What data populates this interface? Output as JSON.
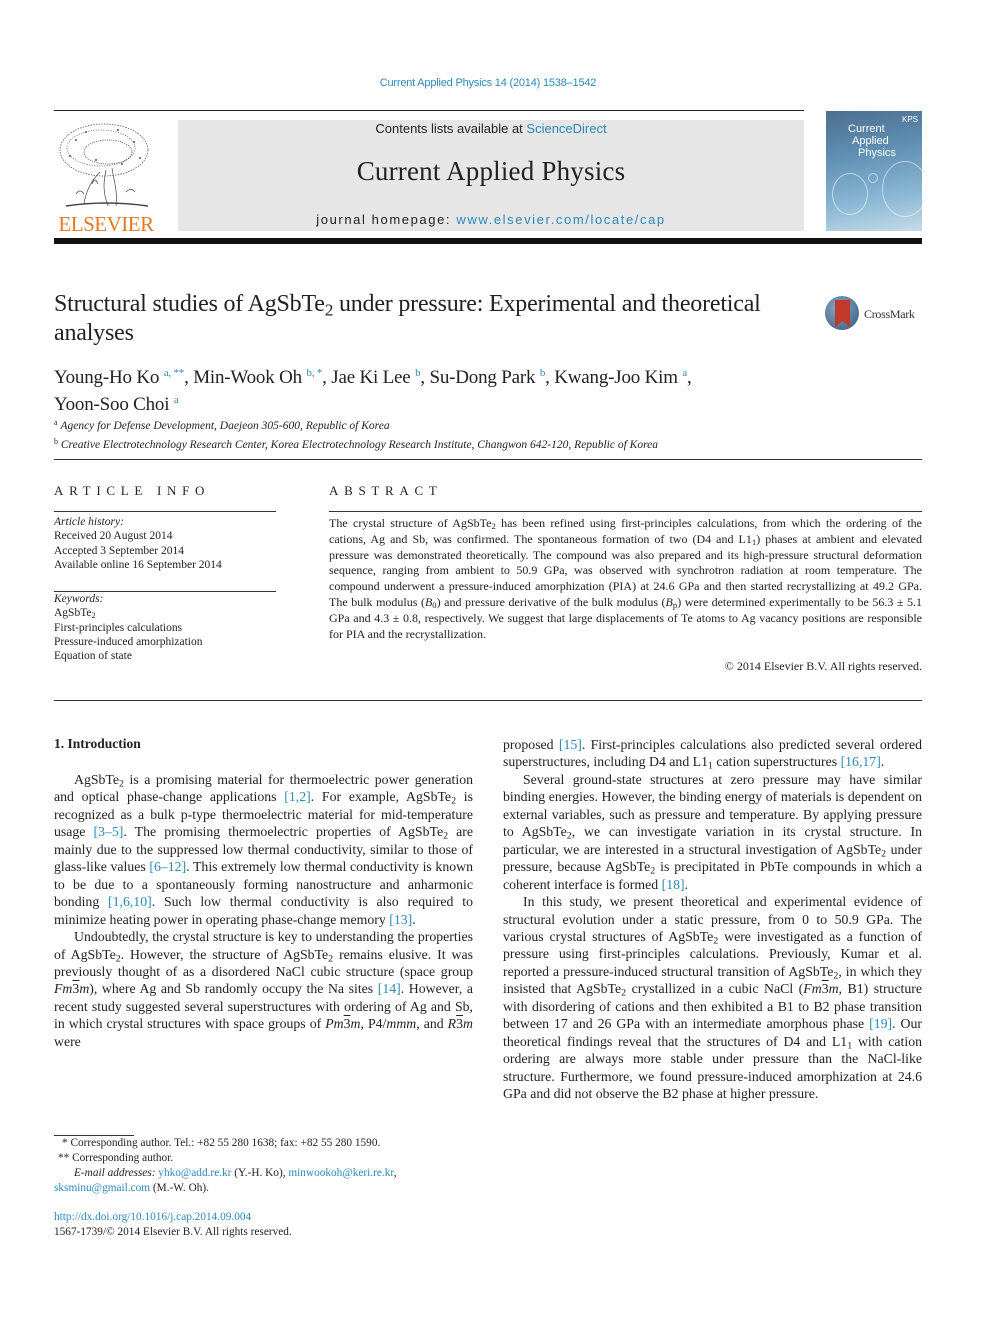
{
  "header": {
    "citation": "Current Applied Physics 14 (2014) 1538–1542",
    "publisher_logo_text": "ELSEVIER",
    "contents_prefix": "Contents lists available at ",
    "contents_link": "ScienceDirect",
    "journal_title": "Current Applied Physics",
    "homepage_prefix": "journal homepage: ",
    "homepage_link": "www.elsevier.com/locate/cap",
    "cover": {
      "line1": "Current",
      "line2": "Applied",
      "line3": "Physics",
      "badge": "KPS"
    },
    "colors": {
      "link": "#2a8ab8",
      "elsevier_orange": "#e87722",
      "masthead_bg": "#e6e6e6"
    }
  },
  "article": {
    "title_part1": "Structural studies of AgSbTe",
    "title_sub": "2",
    "title_part2": " under pressure: Experimental and theoretical analyses",
    "crossmark_label": "CrossMark",
    "authors": [
      {
        "name": "Young-Ho Ko",
        "marks": "a, **",
        "sep": ", "
      },
      {
        "name": "Min-Wook Oh",
        "marks": "b, *",
        "sep": ", "
      },
      {
        "name": "Jae Ki Lee",
        "marks": "b",
        "sep": ", "
      },
      {
        "name": "Su-Dong Park",
        "marks": "b",
        "sep": ", "
      },
      {
        "name": "Kwang-Joo Kim",
        "marks": "a",
        "sep": ", "
      },
      {
        "name": "Yoon-Soo Choi",
        "marks": "a",
        "sep": ""
      }
    ],
    "affiliations": [
      {
        "mark": "a",
        "text": "Agency for Defense Development, Daejeon 305-600, Republic of Korea"
      },
      {
        "mark": "b",
        "text": "Creative Electrotechnology Research Center, Korea Electrotechnology Research Institute, Changwon 642-120, Republic of Korea"
      }
    ]
  },
  "article_info": {
    "heading": "ARTICLE INFO",
    "history_label": "Article history:",
    "history": [
      "Received 20 August 2014",
      "Accepted 3 September 2014",
      "Available online 16 September 2014"
    ],
    "keywords_label": "Keywords:",
    "keyword_formula": "AgSbTe",
    "keyword_formula_sub": "2",
    "keywords": [
      "First-principles calculations",
      "Pressure-induced amorphization",
      "Equation of state"
    ]
  },
  "abstract": {
    "heading": "ABSTRACT",
    "t1": "The crystal structure of AgSbTe",
    "t2": " has been refined using first-principles calculations, from which the ordering of the cations, Ag and Sb, was confirmed. The spontaneous formation of two (D4 and L1",
    "t3": ") phases at ambient and elevated pressure was demonstrated theoretically. The compound was also prepared and its high-pressure structural deformation sequence, ranging from ambient to 50.9 GPa, was observed with synchrotron radiation at room temperature. The compound underwent a pressure-induced amorphization (PIA) at 24.6 GPa and then started recrystallizing at 49.2 GPa. The bulk modulus (",
    "b0": "B",
    "b0_sub": "0",
    "t4": ") and pressure derivative of the bulk modulus (",
    "bp": "B",
    "bp_sub": "p",
    "t5": ") were determined experimentally to be 56.3 ± 5.1 GPa and 4.3 ± 0.8, respectively. We suggest that large displacements of Te atoms to Ag vacancy positions are responsible for PIA and the recrystallization.",
    "sub2": "2",
    "sub1": "1",
    "copyright": "© 2014 Elsevier B.V. All rights reserved."
  },
  "body": {
    "section_heading": "1.  Introduction",
    "formula": "AgSbTe",
    "s2": "2",
    "s1": "1",
    "left": {
      "p1": {
        "a": " is a promising material for thermoelectric power generation and optical phase-change applications ",
        "r1": "[1,2]",
        "b": ". For example, ",
        "c": " is recognized as a bulk p-type thermoelectric material for mid-temperature usage ",
        "r2": "[3–5]",
        "d": ". The promising thermoelectric properties of ",
        "e": " are mainly due to the suppressed low thermal conductivity, similar to those of glass-like values ",
        "r3": "[6–12]",
        "f": ". This extremely low thermal conductivity is known to be due to a spontaneously forming nanostructure and anharmonic bonding ",
        "r4": "[1,6,10]",
        "g": ". Such low thermal conductivity is also required to minimize heating power in operating phase-change memory ",
        "r5": "[13]",
        "h": "."
      },
      "p2": {
        "a": "Undoubtedly, the crystal structure is key to understanding the properties of ",
        "b": ". However, the structure of ",
        "c": " remains elusive. It was previously thought of as a disordered NaCl cubic structure (space group ",
        "sg1a": "Fm",
        "sg1b": "3",
        "sg1c": "m",
        "d": "), where Ag and Sb randomly occupy the Na sites ",
        "r1": "[14]",
        "e": ". However, a recent study suggested several superstructures with ordering of Ag and Sb, in which crystal structures with space groups of ",
        "sg2a": "Pm",
        "sg2b": "3",
        "sg2c": "m",
        "f": ", P4/",
        "sg3": "mmm",
        "g": ", and ",
        "sg4a": "R",
        "sg4b": "3",
        "sg4c": "m",
        "h": " were"
      }
    },
    "right": {
      "p1": {
        "a": "proposed ",
        "r1": "[15]",
        "b": ". First-principles calculations also predicted several ordered superstructures, including D4 and L1",
        "c": " cation superstructures ",
        "r2": "[16,17]",
        "d": "."
      },
      "p2": {
        "a": "Several ground-state structures at zero pressure may have similar binding energies. However, the binding energy of materials is dependent on external variables, such as pressure and temperature. By applying pressure to ",
        "b": ", we can investigate variation in its crystal structure. In particular, we are interested in a structural investigation of ",
        "c": " under pressure, because ",
        "d": " is precipitated in PbTe compounds in which a coherent interface is formed ",
        "r1": "[18]",
        "e": "."
      },
      "p3": {
        "a": "In this study, we present theoretical and experimental evidence of structural evolution under a static pressure, from 0 to 50.9 GPa. The various crystal structures of ",
        "b": " were investigated as a function of pressure using first-principles calculations. Previously, Kumar et al. reported a pressure-induced structural transition of ",
        "c": ", in which they insisted that ",
        "d": " crystallized in a cubic NaCl (",
        "sga": "Fm",
        "sgb": "3",
        "sgc": "m",
        "e": ", B1) structure with disordering of cations and then exhibited a B1 to B2 phase transition between 17 and 26 GPa with an intermediate amorphous phase ",
        "r1": "[19]",
        "f": ". Our theoretical findings reveal that the structures of D4 and L1",
        "g": " with cation ordering are always more stable under pressure than the NaCl-like structure. Furthermore, we found pressure-induced amorphization at 24.6 GPa and did not observe the B2 phase at higher pressure."
      }
    }
  },
  "footnotes": {
    "fn1": "*  Corresponding author. Tel.: +82 55 280 1638; fax: +82 55 280 1590.",
    "fn2": "**  Corresponding author.",
    "email_label": "E-mail addresses: ",
    "email1": "yhko@add.re.kr",
    "email1_owner": " (Y.-H. Ko), ",
    "email2": "minwookoh@keri.re.kr",
    "email_sep": ", ",
    "email3": "sksminu@gmail.com",
    "email3_owner": " (M.-W. Oh).",
    "doi": "http://dx.doi.org/10.1016/j.cap.2014.09.004",
    "issn": "1567-1739/© 2014 Elsevier B.V. All rights reserved."
  }
}
